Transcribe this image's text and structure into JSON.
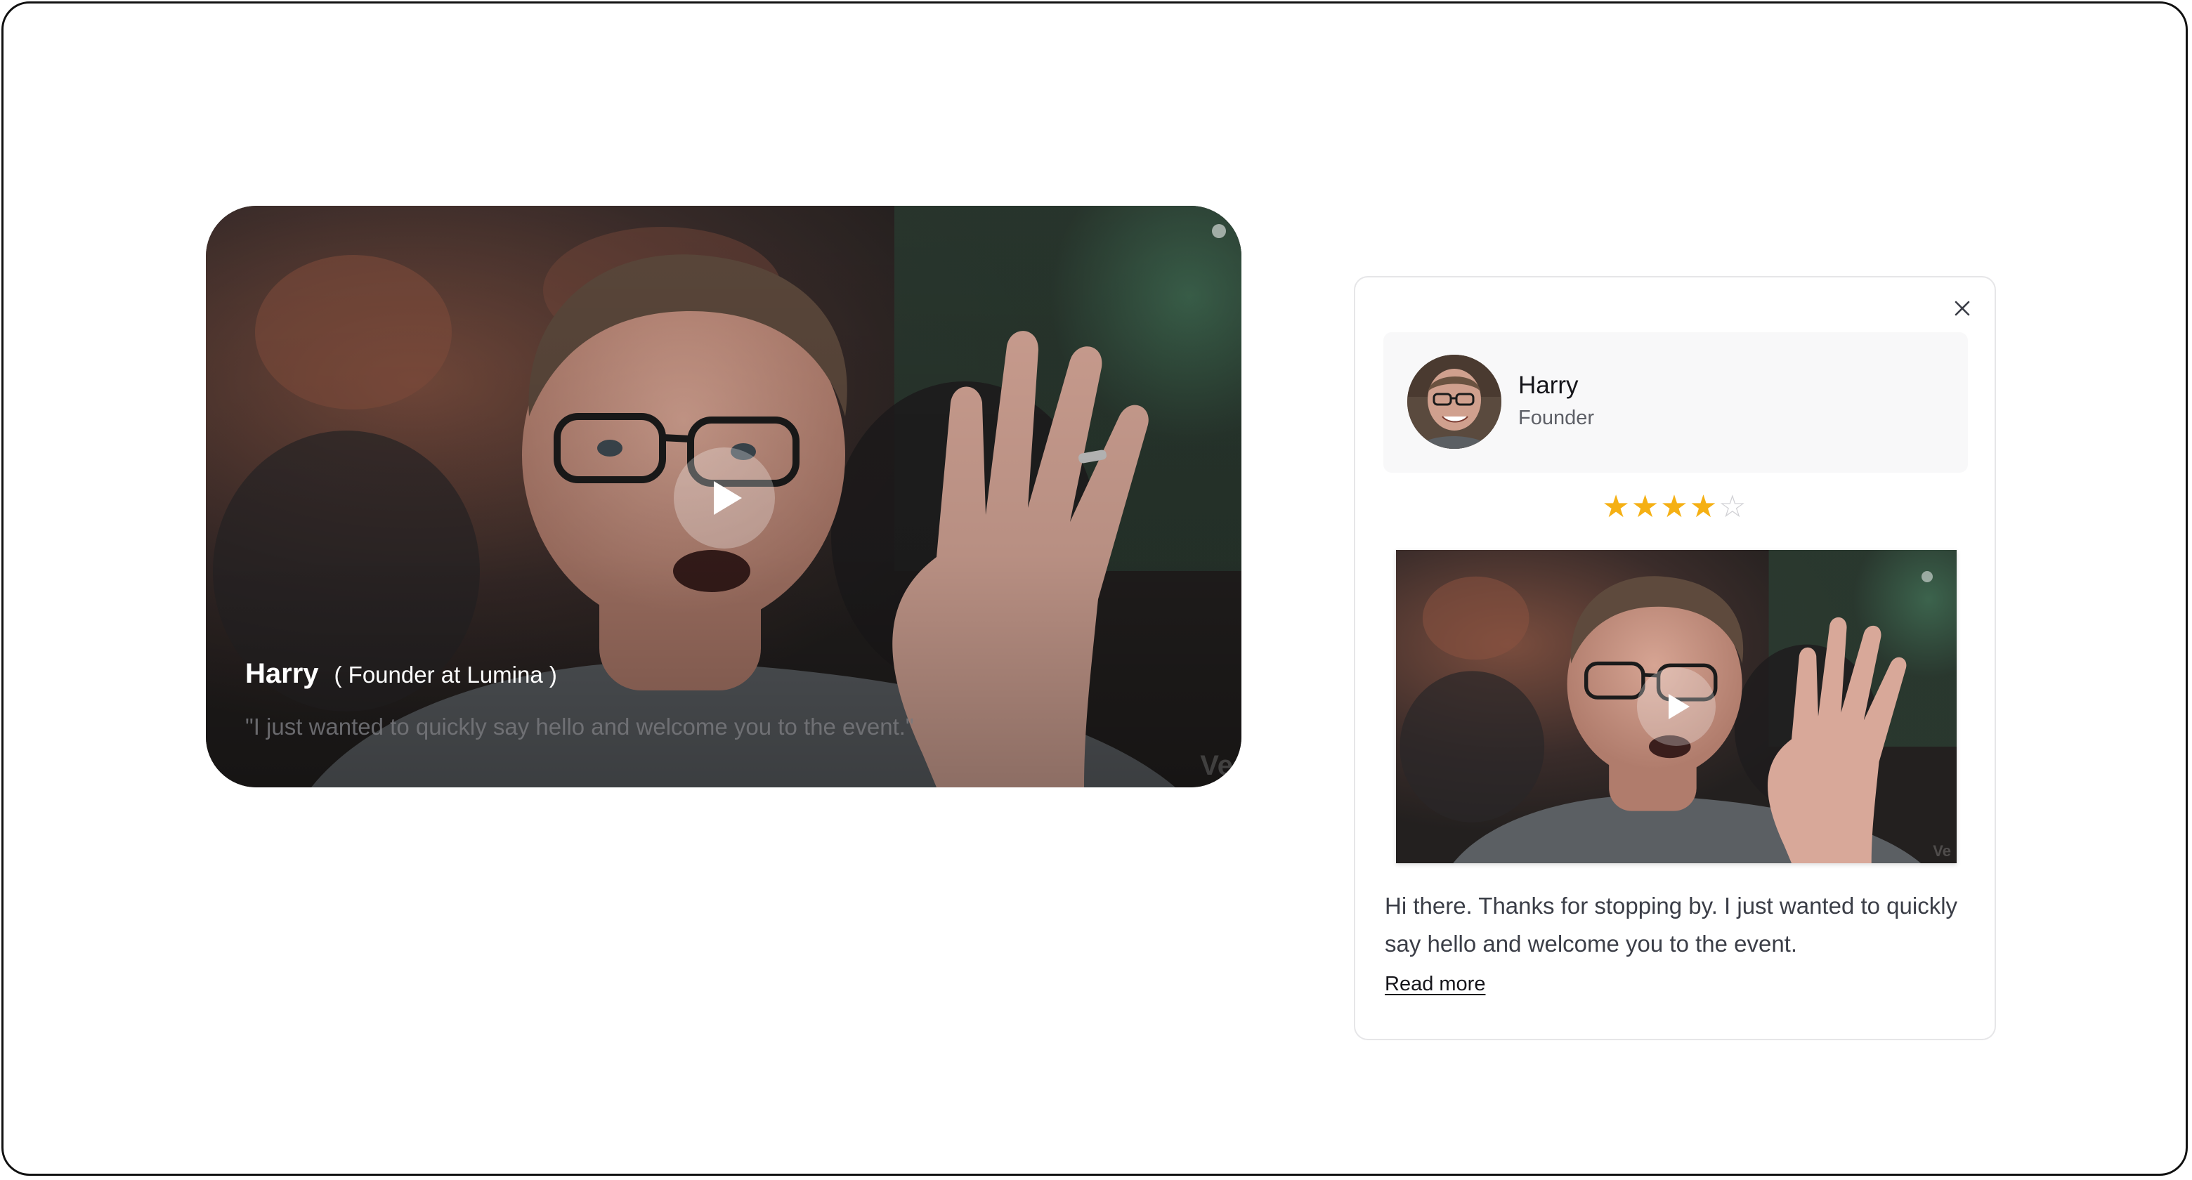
{
  "video_card": {
    "name": "Harry",
    "role": "( Founder at Lumina )",
    "quote": "\"I just wanted to quickly say hello and welcome you to the event.\"",
    "watermark": "Ve"
  },
  "testimonial": {
    "name": "Harry",
    "role": "Founder",
    "rating": 4,
    "rating_max": 5,
    "text": "Hi there. Thanks for stopping by. I just wanted to quickly say hello and welcome you to the event.",
    "read_more_label": "Read more",
    "watermark": "Ve"
  },
  "icons": {
    "close": "close-icon",
    "play": "play-icon",
    "star": "star-icon"
  },
  "colors": {
    "star_filled": "#f5b014",
    "star_empty": "#d0d0d4",
    "text_primary": "#15151a",
    "text_secondary": "#5d5f66"
  }
}
